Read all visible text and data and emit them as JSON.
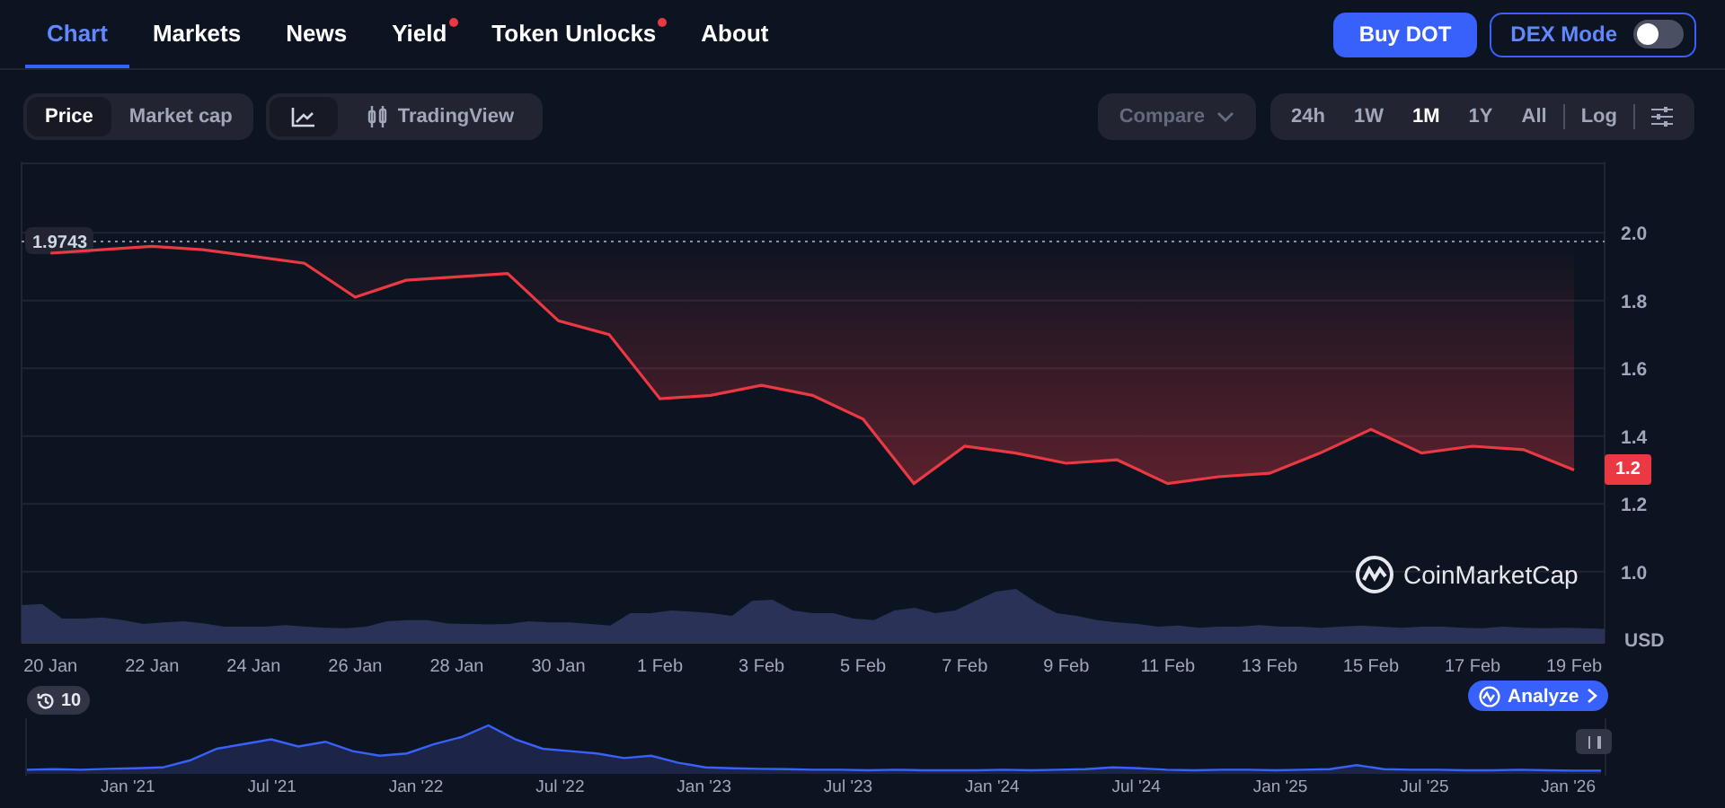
{
  "nav": {
    "tabs": [
      {
        "label": "Chart",
        "selected": true,
        "dot": false
      },
      {
        "label": "Markets",
        "selected": false,
        "dot": false
      },
      {
        "label": "News",
        "selected": false,
        "dot": false
      },
      {
        "label": "Yield",
        "selected": false,
        "dot": true
      },
      {
        "label": "Token Unlocks",
        "selected": false,
        "dot": true
      },
      {
        "label": "About",
        "selected": false,
        "dot": false
      }
    ],
    "buy_button": "Buy DOT",
    "dex_mode": {
      "label": "DEX Mode",
      "on": false
    }
  },
  "toolbar": {
    "metric_tabs": [
      {
        "label": "Price",
        "selected": true
      },
      {
        "label": "Market cap",
        "selected": false
      }
    ],
    "view_tabs": [
      {
        "kind": "line",
        "selected": true
      },
      {
        "kind": "tradingview",
        "label": "TradingView",
        "selected": false
      }
    ],
    "compare": "Compare",
    "ranges": [
      {
        "label": "24h",
        "selected": false
      },
      {
        "label": "1W",
        "selected": false
      },
      {
        "label": "1M",
        "selected": true
      },
      {
        "label": "1Y",
        "selected": false
      },
      {
        "label": "All",
        "selected": false
      }
    ],
    "log": "Log"
  },
  "chart": {
    "current_price": "1.2",
    "currency": "USD",
    "watermark": "CoinMarketCap",
    "chart_data": {
      "type": "line",
      "categories": [
        "20 Jan",
        null,
        "22 Jan",
        null,
        "24 Jan",
        null,
        "26 Jan",
        null,
        "28 Jan",
        null,
        "30 Jan",
        null,
        "1 Feb",
        null,
        "3 Feb",
        null,
        "5 Feb",
        null,
        "7 Feb",
        null,
        "9 Feb",
        null,
        "11 Feb",
        null,
        "13 Feb",
        null,
        "15 Feb",
        null,
        "17 Feb",
        null,
        "19 Feb"
      ],
      "ylim": [
        0.79,
        2.21
      ],
      "grid": true,
      "ref_lines": [
        {
          "axis": "y",
          "value": 1.9743,
          "label": "1.9743"
        }
      ],
      "yticks": [
        {
          "value": 1.0,
          "label": "1.0"
        },
        1.2,
        1.4,
        1.6,
        1.8,
        {
          "value": 2.0,
          "label": "2.0"
        }
      ],
      "series": [
        {
          "color": "#ea3943",
          "values": [
            1.94,
            1.95,
            1.96,
            1.95,
            1.93,
            1.91,
            1.81,
            1.86,
            1.87,
            1.88,
            1.74,
            1.7,
            1.51,
            1.52,
            1.55,
            1.52,
            1.45,
            1.26,
            1.37,
            1.35,
            1.32,
            1.33,
            1.26,
            1.28,
            1.29,
            1.35,
            1.42,
            1.35,
            1.37,
            1.36,
            1.3
          ]
        }
      ]
    }
  },
  "navigator": {
    "history_count": "10",
    "analyze": "Analyze",
    "labels": [
      "Jan '21",
      "Jul '21",
      "Jan '22",
      "Jul '22",
      "Jan '23",
      "Jul '23",
      "Jan '24",
      "Jul '24",
      "Jan '25",
      "Jul '25",
      "Jan '26"
    ]
  }
}
